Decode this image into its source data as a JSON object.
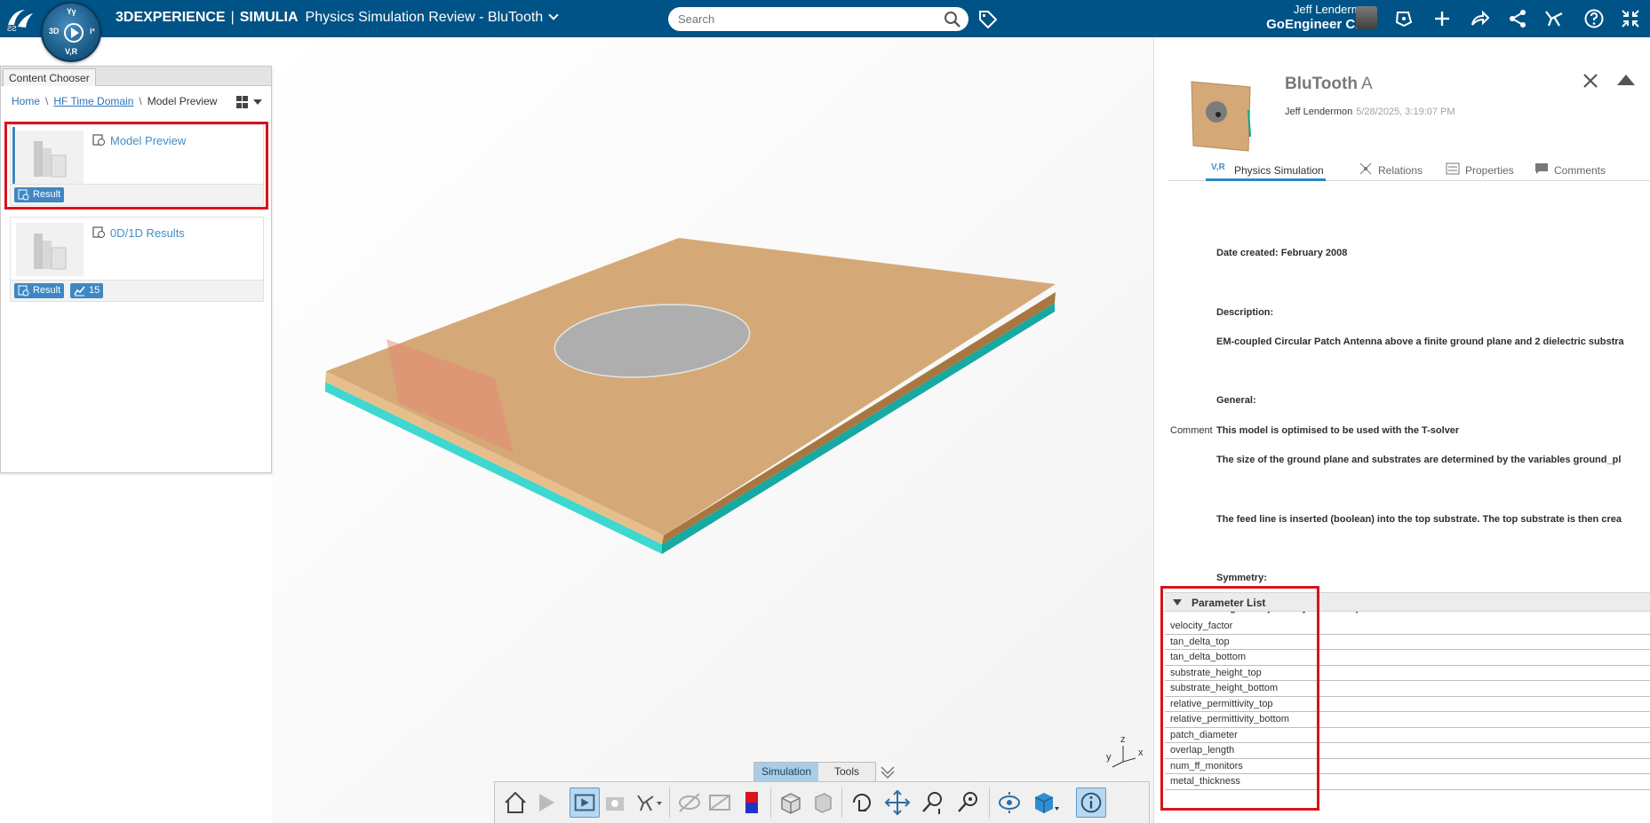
{
  "header": {
    "brand_bold": "3DEXPERIENCE",
    "brand_app": "SIMULIA",
    "context_title": "Physics Simulation Review - BluTooth",
    "search_placeholder": "Search",
    "user_name": "Jeff Lendermon",
    "user_company": "GoEngineer CRE",
    "compass_labels": {
      "top": "Υγ",
      "left": "3D",
      "right": "i³",
      "bottom": "V,R"
    },
    "icons": [
      "bookmark-tag-icon",
      "notifications-icon",
      "add-icon",
      "share-icon",
      "social-share-icon",
      "community-icon",
      "help-icon",
      "fullscreen-icon"
    ]
  },
  "content_chooser": {
    "tab_label": "Content Chooser",
    "breadcrumb": {
      "home": "Home",
      "domain": "HF Time Domain",
      "current": "Model Preview"
    },
    "cards": [
      {
        "name": "Model Preview",
        "badges": [
          {
            "label": "Result"
          }
        ]
      },
      {
        "name": "0D/1D Results",
        "badges": [
          {
            "label": "Result"
          },
          {
            "label": "15"
          }
        ]
      }
    ]
  },
  "viewport": {
    "axis_labels": {
      "x": "x",
      "y": "y",
      "z": "z"
    },
    "tabs": {
      "simulation": "Simulation",
      "tools": "Tools"
    },
    "action_icons": [
      "home-view-icon",
      "play-icon",
      "view-mode-icon",
      "capture-icon",
      "connectors-icon",
      "hide-show-icon",
      "section-icon",
      "color-legend-icon",
      "mesh-icon",
      "material-icon",
      "rotate-icon",
      "pan-icon",
      "zoom-fit-icon",
      "zoom-icon",
      "visibility-icon",
      "render-style-icon",
      "info-icon"
    ]
  },
  "right_panel": {
    "title": "BluTooth",
    "revision": "A",
    "owner": "Jeff Lendermon",
    "modified": "5/28/2025, 3:19:07 PM",
    "tabs": {
      "simulation_badge": "V,R",
      "simulation": "Physics Simulation",
      "relations": "Relations",
      "properties": "Properties",
      "comments": "Comments"
    },
    "details": {
      "date_created": "Date created: February 2008",
      "description_heading": "Description:",
      "description_text": "EM-coupled Circular Patch Antenna above a finite ground plane and 2 dielectric substra",
      "general_heading": "General:",
      "comment_label": "Comment",
      "comment_line1": "This model is optimised to be used with the T-solver",
      "comment_line2": "The size of the ground plane and substrates are determined by the variables ground_pl",
      "comment_line3": "The feed line is inserted (boolean) into the top substrate. The top substrate is then crea",
      "symmetry_heading": "Symmetry:",
      "symmetry_text": "Magnetic symmetry in the x-z plane is used to reduce simulation time"
    },
    "parameter_list_title": "Parameter List",
    "parameters": [
      "velocity_factor",
      "tan_delta_top",
      "tan_delta_bottom",
      "substrate_height_top",
      "substrate_height_bottom",
      "relative_permittivity_top",
      "relative_permittivity_bottom",
      "patch_diameter",
      "overlap_length",
      "num_ff_monitors",
      "metal_thickness"
    ]
  },
  "colors": {
    "header_bg": "#005386",
    "accent_blue": "#3d88c4",
    "highlight_red": "#d8131b",
    "board_top": "#d5a977",
    "board_edge": "#3fd8d0"
  }
}
